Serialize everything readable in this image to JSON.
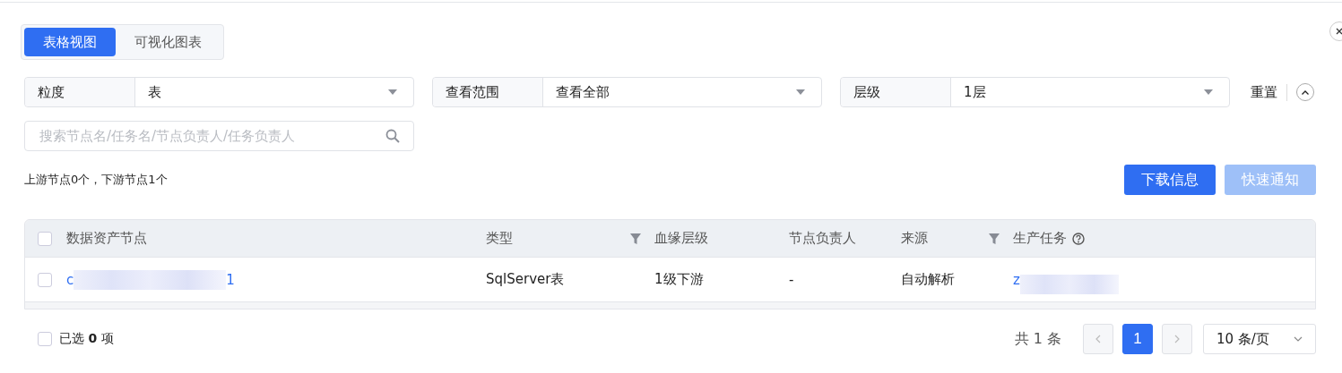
{
  "view_tabs": [
    {
      "label": "表格视图",
      "selected": true
    },
    {
      "label": "可视化图表",
      "selected": false
    }
  ],
  "filters": [
    {
      "label": "粒度",
      "value": "表"
    },
    {
      "label": "查看范围",
      "value": "查看全部"
    },
    {
      "label": "层级",
      "value": "1层"
    }
  ],
  "reset": "重置",
  "search": {
    "placeholder": "搜索节点名/任务名/节点负责人/任务负责人"
  },
  "summary": "上游节点0个，下游节点1个",
  "buttons": [
    {
      "label": "下载信息",
      "disabled": false
    },
    {
      "label": "快速通知",
      "disabled": true
    }
  ],
  "table": {
    "header_checked": false,
    "columns": [
      {
        "label": "数据资产节点",
        "kind": "plain"
      },
      {
        "label": "类型",
        "kind": "filter"
      },
      {
        "label": "血缘层级",
        "kind": "plain"
      },
      {
        "label": "节点负责人",
        "kind": "plain"
      },
      {
        "label": "来源",
        "kind": "filter"
      },
      {
        "label": "生产任务",
        "kind": "help"
      }
    ],
    "rows": [
      {
        "checked": false,
        "cells": [
          {
            "kind": "redacted-link",
            "start": "c",
            "end": "1"
          },
          {
            "kind": "text",
            "text": "SqlServer表"
          },
          {
            "kind": "text",
            "text": "1级下游"
          },
          {
            "kind": "text",
            "text": "-"
          },
          {
            "kind": "text",
            "text": "自动解析"
          },
          {
            "kind": "redacted-link",
            "start": "z"
          }
        ]
      }
    ]
  },
  "footer": {
    "selected_prefix": "已选",
    "selected_count": "0",
    "selected_suffix": "项",
    "select_all_checked": false,
    "total": "共 1 条",
    "pages": [
      {
        "label": "1",
        "selected": true
      }
    ],
    "page_size": "10 条/页"
  }
}
